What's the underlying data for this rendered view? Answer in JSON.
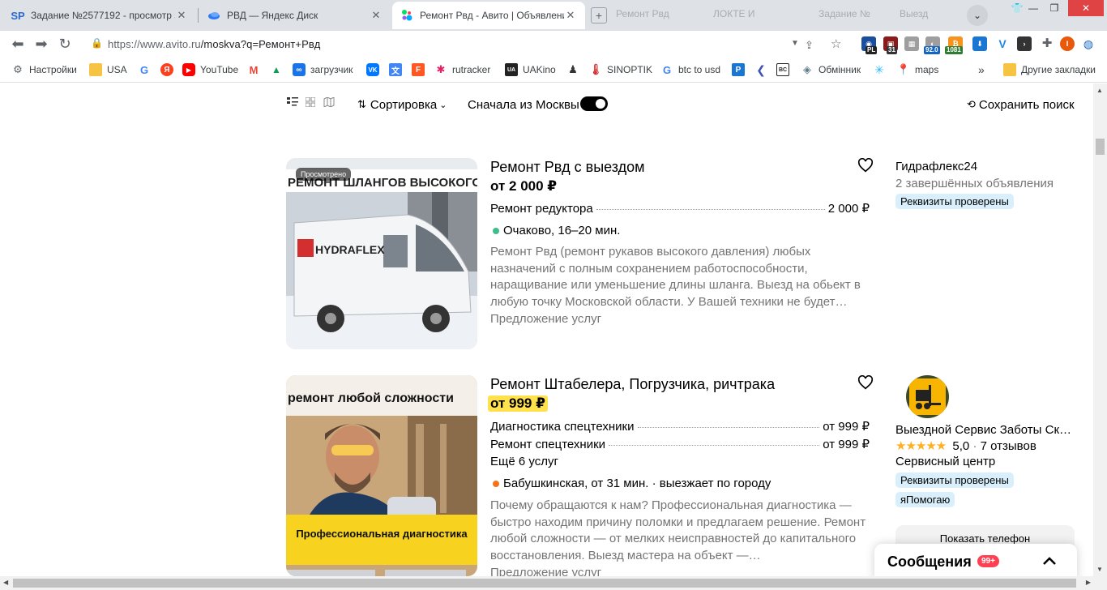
{
  "browser": {
    "tabs": [
      {
        "title": "Задание №2577192 - просмотр з",
        "favicon": "SP"
      },
      {
        "title": "РВД — Яндекс Диск",
        "favicon": "yandex-disk-icon"
      },
      {
        "title": "Ремонт Рвд - Авито | Объявления",
        "favicon": "avito-icon"
      }
    ],
    "ghost_tabs": [
      "Ремонт Рвд",
      "ЛОКТЕ И",
      "Задание №",
      "Выезд"
    ],
    "url_host": "https://www.avito.ru",
    "url_path": "/moskva?q=Ремонт+Рвд",
    "extensions": {
      "badge_1": "PL",
      "badge_2": "31",
      "badge_3": "92.0",
      "badge_4": "1081",
      "profile_letter": "I"
    }
  },
  "bookmarks": [
    {
      "label": "Настройки",
      "color": "#5f6368"
    },
    {
      "label": "USA",
      "color": "#f6c342"
    },
    {
      "label": "",
      "color": "#4285f4"
    },
    {
      "label": "",
      "color": "#fc3f1d"
    },
    {
      "label": "YouTube",
      "color": "#ff0000"
    },
    {
      "label": "",
      "color": "#ea4335"
    },
    {
      "label": "",
      "color": "#0f9d58"
    },
    {
      "label": "загрузчик",
      "color": "#1a73e8"
    },
    {
      "label": "",
      "color": "#0077ff"
    },
    {
      "label": "",
      "color": "#4285f4"
    },
    {
      "label": "",
      "color": "#ff5722"
    },
    {
      "label": "rutracker",
      "color": "#e91e63"
    },
    {
      "label": "UAKino",
      "color": "#222222"
    },
    {
      "label": "",
      "color": "#333333"
    },
    {
      "label": "SINOPTIK",
      "color": "#d32f2f"
    },
    {
      "label": "btc to usd",
      "color": "#4285f4"
    },
    {
      "label": "",
      "color": "#1976d2"
    },
    {
      "label": "",
      "color": "#3f51b5"
    },
    {
      "label": "",
      "color": "#222222"
    },
    {
      "label": "Обмінник",
      "color": "#607d8b"
    },
    {
      "label": "",
      "color": "#29b6f6"
    },
    {
      "label": "maps",
      "color": "#34a853"
    }
  ],
  "bookmarks_more": "»",
  "other_bookmarks": "Другие закладки",
  "controls": {
    "sort_label": "Сортировка",
    "moscow_first_label": "Сначала из Москвы",
    "save_search_label": "Сохранить поиск"
  },
  "listings": [
    {
      "title": "Ремонт Рвд с выездом",
      "price": "от 2 000 ₽",
      "price_highlight": false,
      "seen_label": "Просмотрено",
      "services": [
        {
          "name": "Ремонт редуктора",
          "price": "2 000 ₽"
        }
      ],
      "more_services": "",
      "location": "Очаково, 16–20 мин.",
      "location_color": "#3ebd8a",
      "description": "Ремонт Рвд (ремонт рукавов высокого давления) любых назначений с полным сохранением работоспособности, наращивание или уменьшение длины шланга. Выезд на обьект в любую точку Московской области. У Вашей техники не будет…",
      "category": "Предложение услуг",
      "photo_banner": "РЕМОНТ ШЛАНГОВ ВЫСОКОГО ДАВЛ",
      "photo_logo": "HYDRAFLEX",
      "seller": {
        "name": "Гидрафлекс24",
        "sub": "2 завершённых объявления",
        "rating": "",
        "reviews": "",
        "type": "",
        "badges": [
          "Реквизиты проверены"
        ]
      }
    },
    {
      "title": "Ремонт Штабелера, Погрузчика, ричтрака",
      "price": "от 999 ₽",
      "price_highlight": true,
      "seen_label": "",
      "services": [
        {
          "name": "Диагностика спецтехники",
          "price": "от 999 ₽"
        },
        {
          "name": "Ремонт спецтехники",
          "price": "от 999 ₽"
        }
      ],
      "more_services": "Ещё 6 услуг",
      "location": "Бабушкинская, от 31 мин. · выезжает по городу",
      "location_color": "#f5731a",
      "description": "Почему обращаются к нам? Профессиональная диагностика — быстро находим причину поломки и предлагаем решение. Ремонт любой сложности — от мелких неисправностей до капитального восстановления. Выезд мастера на объект —…",
      "category": "Предложение услуг",
      "photo_banner": "ремонт любой сложности",
      "photo_caption": "Профессиональная диагностика",
      "seller": {
        "name": "Выездной Сервис Заботы Ск…",
        "sub": "",
        "rating": "5,0",
        "reviews": "7 отзывов",
        "type": "Сервисный центр",
        "badges": [
          "Реквизиты проверены",
          "яПомогаю"
        ],
        "phone_button": "Показать телефон"
      }
    }
  ],
  "messenger": {
    "label": "Сообщения",
    "count": "99+"
  }
}
